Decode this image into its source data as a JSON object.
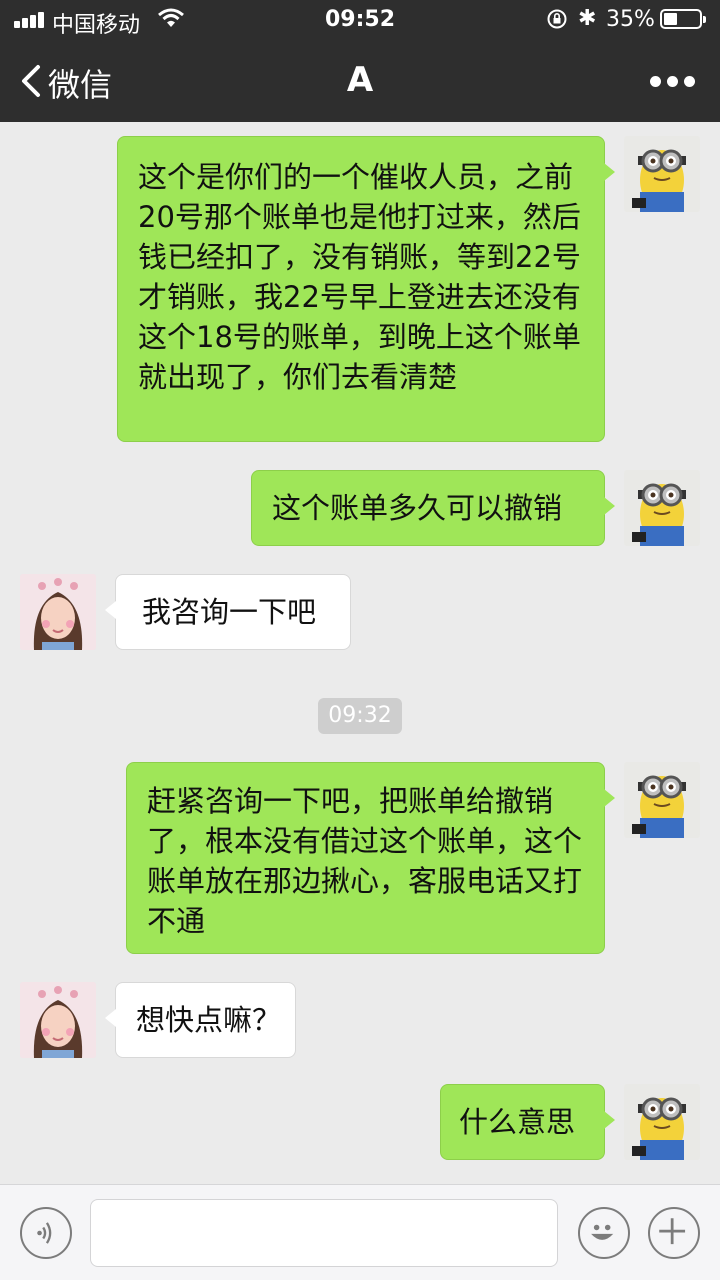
{
  "status_bar": {
    "carrier": "中国移动",
    "time": "09:52",
    "battery_percent": "35%",
    "battery_level": 0.35
  },
  "nav": {
    "back_label": "微信",
    "title": "A"
  },
  "messages": [
    {
      "sender": "me",
      "text": "这个是你们的一个催收人员，之前20号那个账单也是他打过来，然后钱已经扣了，没有销账，等到22号才销账，我22号早上登进去还没有这个18号的账单，到晚上这个账单就出现了，你们去看清楚"
    },
    {
      "sender": "me",
      "text": "这个账单多久可以撤销"
    },
    {
      "sender": "other",
      "text": "我咨询一下吧"
    },
    {
      "sender": "me",
      "text": "赶紧咨询一下吧，把账单给撤销了，根本没有借过这个账单，这个账单放在那边揪心，客服电话又打不通"
    },
    {
      "sender": "other",
      "text": "想快点嘛？"
    },
    {
      "sender": "me",
      "text": "什么意思"
    }
  ],
  "timestamp": "09:32",
  "input": {
    "value": ""
  },
  "colors": {
    "header_bg": "#2e2e2e",
    "chat_bg": "#ebebeb",
    "my_bubble": "#9fe658",
    "their_bubble": "#ffffff"
  },
  "icons": [
    "signal-icon",
    "wifi-icon",
    "rotation-lock-icon",
    "bluetooth-icon",
    "battery-icon",
    "back-chevron-icon",
    "more-icon",
    "voice-icon",
    "emoji-icon",
    "plus-icon",
    "minion-avatar",
    "contact-avatar"
  ]
}
